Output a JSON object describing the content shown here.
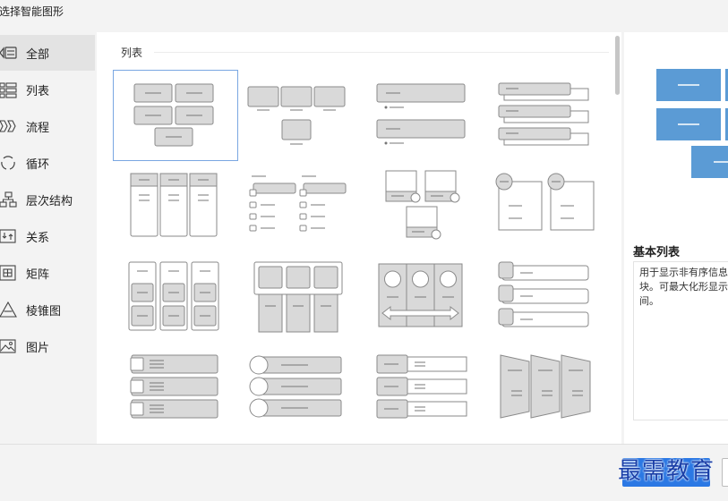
{
  "window": {
    "title": "选择智能图形"
  },
  "sidebar": {
    "items": [
      {
        "label": "全部",
        "icon": "all-icon",
        "active": true
      },
      {
        "label": "列表",
        "icon": "list-icon"
      },
      {
        "label": "流程",
        "icon": "process-icon"
      },
      {
        "label": "循环",
        "icon": "cycle-icon"
      },
      {
        "label": "层次结构",
        "icon": "hierarchy-icon"
      },
      {
        "label": "关系",
        "icon": "relationship-icon"
      },
      {
        "label": "矩阵",
        "icon": "matrix-icon"
      },
      {
        "label": "棱锥图",
        "icon": "pyramid-icon"
      },
      {
        "label": "图片",
        "icon": "picture-icon"
      }
    ]
  },
  "gallery": {
    "section_title": "列表",
    "thumbnail_count": 16
  },
  "preview": {
    "title": "基本列表",
    "description": "用于显示非有序信息块。可最大化形显示空间。",
    "accent_color": "#5b9bd5"
  },
  "footer": {
    "watermark": "最需教育"
  },
  "colors": {
    "selection_outline": "#7aa7e2",
    "shape_fill": "#d9d9d9",
    "shape_stroke": "#7f7f7f",
    "ok_button": "#2b78e4"
  }
}
